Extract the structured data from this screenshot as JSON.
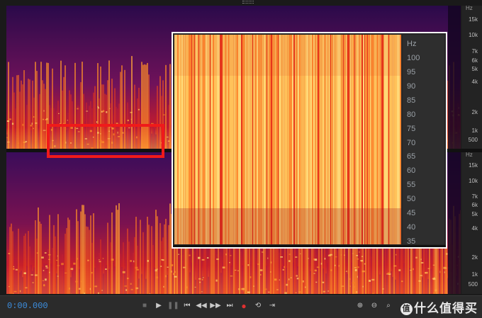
{
  "freq_ruler": {
    "unit": "Hz",
    "labels": [
      "15k",
      "10k",
      "7k",
      "6k",
      "5k",
      "4k",
      "2k",
      "1k",
      "500"
    ]
  },
  "zoom_inset": {
    "unit": "Hz",
    "labels": [
      "100",
      "95",
      "90",
      "85",
      "80",
      "75",
      "70",
      "65",
      "60",
      "55",
      "50",
      "45",
      "40",
      "35"
    ]
  },
  "transport": {
    "time": "0:00.000",
    "buttons": [
      "stop",
      "play",
      "pause",
      "go-to-start",
      "rewind",
      "fast-forward",
      "go-to-end",
      "record",
      "loop",
      "skip-selection"
    ]
  },
  "zoom_buttons": [
    "zoom-in-amplitude",
    "zoom-out-amplitude",
    "zoom-selection",
    "zoom-out-full"
  ],
  "watermark": {
    "badge": "值",
    "text": "什么值得买"
  },
  "colors": {
    "spectrum_low": "#2a0a4a",
    "spectrum_mid": "#c0182a",
    "spectrum_high": "#ffd070",
    "highlight": "#f01a1a",
    "time_display": "#3d8fe0"
  }
}
